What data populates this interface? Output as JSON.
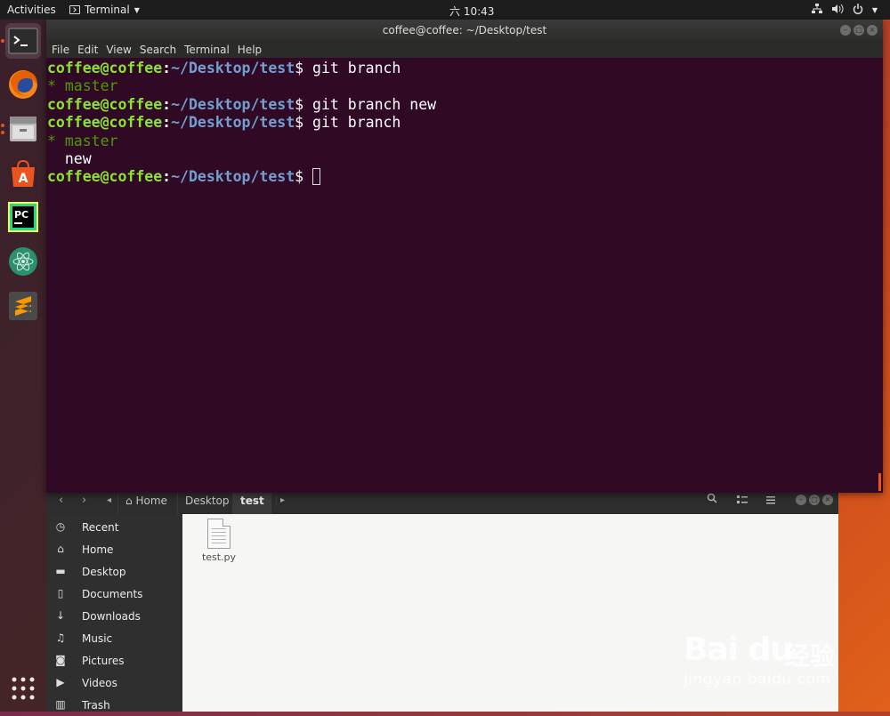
{
  "topbar": {
    "activities": "Activities",
    "app_menu": "Terminal",
    "clock": "六 10:43"
  },
  "dock": {
    "items": [
      "terminal-icon",
      "firefox-icon",
      "files-icon",
      "software-center-icon",
      "pycharm-icon",
      "atom-icon",
      "sublime-text-icon"
    ],
    "show_apps": "show-applications-icon"
  },
  "terminal": {
    "title": "coffee@coffee: ~/Desktop/test",
    "menu": [
      "File",
      "Edit",
      "View",
      "Search",
      "Terminal",
      "Help"
    ],
    "prompt_user": "coffee@coffee",
    "prompt_colon": ":",
    "prompt_path": "~/Desktop/test",
    "prompt_dollar": "$ ",
    "lines": [
      {
        "type": "cmd",
        "text": "git branch"
      },
      {
        "type": "branch_current",
        "text": "* master"
      },
      {
        "type": "cmd",
        "text": "git branch new"
      },
      {
        "type": "cmd",
        "text": "git branch"
      },
      {
        "type": "branch_current",
        "text": "* master"
      },
      {
        "type": "plain",
        "text": "  new"
      },
      {
        "type": "cmd",
        "text": ""
      }
    ]
  },
  "files": {
    "breadcrumbs": [
      "Home",
      "Desktop",
      "test"
    ],
    "sidebar": [
      {
        "label": "Recent",
        "icon": "clock-icon"
      },
      {
        "label": "Home",
        "icon": "home-icon"
      },
      {
        "label": "Desktop",
        "icon": "folder-icon"
      },
      {
        "label": "Documents",
        "icon": "document-icon"
      },
      {
        "label": "Downloads",
        "icon": "download-icon"
      },
      {
        "label": "Music",
        "icon": "music-icon"
      },
      {
        "label": "Pictures",
        "icon": "camera-icon"
      },
      {
        "label": "Videos",
        "icon": "video-icon"
      },
      {
        "label": "Trash",
        "icon": "trash-icon"
      }
    ],
    "file_items": [
      {
        "name": "test.py",
        "icon": "text-file-icon"
      }
    ]
  },
  "watermark": {
    "logo": "Bai du",
    "cn": "经验",
    "url": "jingyan.baidu.com"
  },
  "colors": {
    "terminal_bg": "#300a24",
    "prompt_user": "#8ae234",
    "prompt_path": "#729fcf",
    "branch_current": "#4e9a06",
    "accent": "#e95420"
  }
}
